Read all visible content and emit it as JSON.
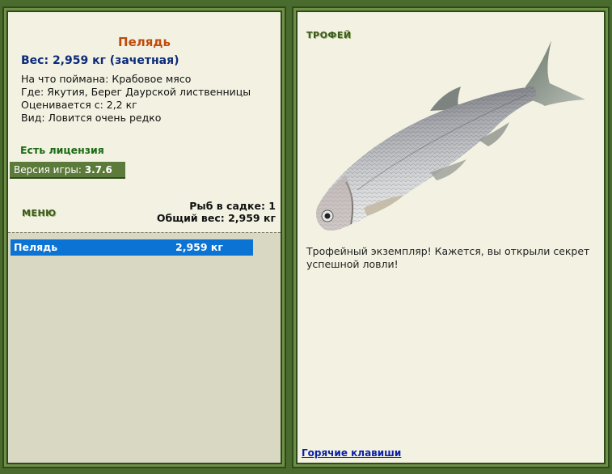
{
  "fish": {
    "name": "Пелядь",
    "weight_line": "Вес: 2,959 кг (зачетная)",
    "bait": "На что поймана: Крабовое мясо",
    "location": "Где: Якутия, Берег Даурской лиственницы",
    "valued_from": "Оценивается с: 2,2 кг",
    "rarity": "Вид: Ловится очень редко"
  },
  "license": "Есть лицензия",
  "version": {
    "label": "Версия игры:",
    "value": "3.7.6"
  },
  "menu_label": "МЕНЮ",
  "keepnet": {
    "count_label": "Рыб в садке: 1",
    "total_label": "Общий вес: 2,959 кг"
  },
  "list": [
    {
      "name": "Пелядь",
      "weight": "2,959 кг"
    }
  ],
  "trophy": {
    "title": "ТРОФЕЙ",
    "text": "Трофейный экземпляр! Кажется, вы открыли секрет успешной ловли!"
  },
  "hotkeys": "Горячие клавиши",
  "colors": {
    "frame": "#4a6b2e",
    "panel": "#f3f2e2",
    "list_bg": "#d9d8c2",
    "selected_row": "#0a73d4",
    "fish_name": "#c04a0c",
    "weight": "#0d2a7a",
    "license": "#1c6a14",
    "link": "#0a1faa"
  }
}
